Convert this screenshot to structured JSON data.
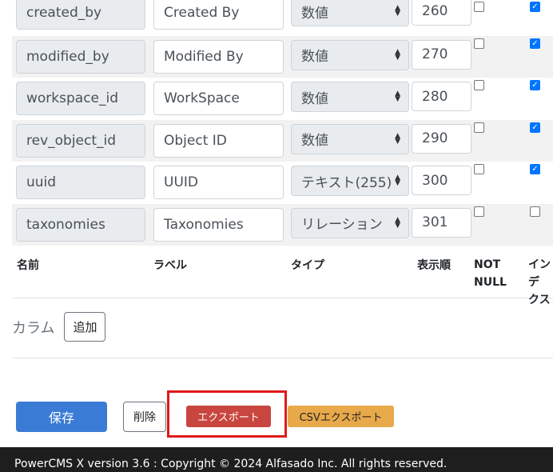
{
  "rows": [
    {
      "name": "created_by",
      "label": "Created By",
      "type": "数値",
      "order": "260",
      "not_null": false,
      "index": true
    },
    {
      "name": "modified_by",
      "label": "Modified By",
      "type": "数値",
      "order": "270",
      "not_null": false,
      "index": true
    },
    {
      "name": "workspace_id",
      "label": "WorkSpace",
      "type": "数値",
      "order": "280",
      "not_null": false,
      "index": true
    },
    {
      "name": "rev_object_id",
      "label": "Object ID",
      "type": "数値",
      "order": "290",
      "not_null": false,
      "index": true
    },
    {
      "name": "uuid",
      "label": "UUID",
      "type": "テキスト(255)",
      "order": "300",
      "not_null": false,
      "index": true
    },
    {
      "name": "taxonomies",
      "label": "Taxonomies",
      "type": "リレーション",
      "order": "301",
      "not_null": false,
      "index": false
    }
  ],
  "header": {
    "name": "名前",
    "label": "ラベル",
    "type": "タイプ",
    "order": "表示順",
    "not_null_1": "NOT",
    "not_null_2": "NULL",
    "index_1": "インデ",
    "index_2": "クス"
  },
  "column_add": {
    "label": "カラム",
    "button": "追加"
  },
  "actions": {
    "save": "保存",
    "delete": "削除",
    "export": "エクスポート",
    "csv_export": "CSVエクスポート"
  },
  "footer": {
    "text": "PowerCMS X version 3.6 : Copyright © 2024 Alfasado Inc. All rights reserved."
  },
  "colors": {
    "primary": "#3a7bd5",
    "danger": "#c9453f",
    "warning": "#e8a94a",
    "highlight": "#e01919",
    "footer_bg": "#1e1e1e"
  }
}
